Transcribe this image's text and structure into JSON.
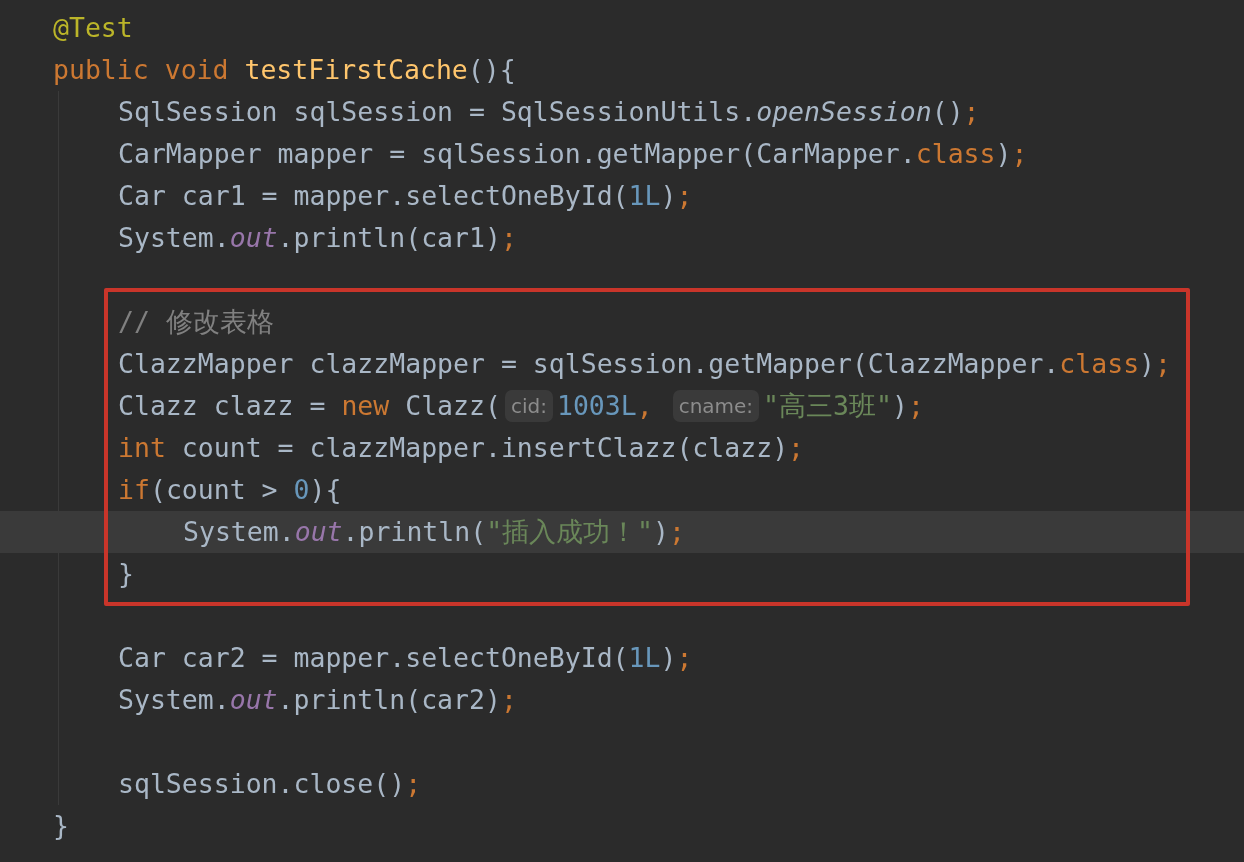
{
  "lines": [
    {
      "kind": "line",
      "tokens": [
        {
          "kind": "annotation",
          "text": "@Test"
        }
      ]
    },
    {
      "kind": "line",
      "tokens": [
        {
          "kind": "keyword",
          "text": "public void "
        },
        {
          "kind": "method",
          "text": "testFirstCache"
        },
        {
          "kind": "plain",
          "text": "(){"
        }
      ],
      "children": [
        {
          "kind": "line",
          "tokens": [
            {
              "kind": "plain",
              "text": "SqlSession sqlSession = SqlSessionUtils."
            },
            {
              "kind": "italic",
              "text": "openSession"
            },
            {
              "kind": "plain",
              "text": "()"
            },
            {
              "kind": "keyword",
              "text": ";"
            }
          ]
        },
        {
          "kind": "line",
          "tokens": [
            {
              "kind": "plain",
              "text": "CarMapper mapper = sqlSession.getMapper(CarMapper."
            },
            {
              "kind": "keyword",
              "text": "class"
            },
            {
              "kind": "plain",
              "text": ")"
            },
            {
              "kind": "keyword",
              "text": ";"
            }
          ]
        },
        {
          "kind": "line",
          "tokens": [
            {
              "kind": "plain",
              "text": "Car car1 = mapper.selectOneById("
            },
            {
              "kind": "number",
              "text": "1L"
            },
            {
              "kind": "plain",
              "text": ")"
            },
            {
              "kind": "keyword",
              "text": ";"
            }
          ]
        },
        {
          "kind": "line",
          "tokens": [
            {
              "kind": "plain",
              "text": "System."
            },
            {
              "kind": "field",
              "text": "out"
            },
            {
              "kind": "plain",
              "text": ".println(car1)"
            },
            {
              "kind": "keyword",
              "text": ";"
            }
          ]
        },
        {
          "kind": "blank"
        },
        {
          "kind": "frame",
          "children": [
            {
              "kind": "line",
              "tokens": [
                {
                  "kind": "comment",
                  "text": "// 修改表格"
                }
              ]
            },
            {
              "kind": "line",
              "tokens": [
                {
                  "kind": "plain",
                  "text": "ClazzMapper clazzMapper = sqlSession.getMapper(ClazzMapper."
                },
                {
                  "kind": "keyword",
                  "text": "class"
                },
                {
                  "kind": "plain",
                  "text": ")"
                },
                {
                  "kind": "keyword",
                  "text": ";"
                }
              ]
            },
            {
              "kind": "line",
              "tokens": [
                {
                  "kind": "plain",
                  "text": "Clazz clazz = "
                },
                {
                  "kind": "keyword",
                  "text": "new "
                },
                {
                  "kind": "plain",
                  "text": "Clazz("
                },
                {
                  "kind": "hint",
                  "text": "cid:"
                },
                {
                  "kind": "number",
                  "text": "1003L"
                },
                {
                  "kind": "keyword",
                  "text": ", "
                },
                {
                  "kind": "hint",
                  "text": "cname:"
                },
                {
                  "kind": "string",
                  "text": "\"高三3班\""
                },
                {
                  "kind": "plain",
                  "text": ")"
                },
                {
                  "kind": "keyword",
                  "text": ";"
                }
              ]
            },
            {
              "kind": "line",
              "tokens": [
                {
                  "kind": "keyword",
                  "text": "int "
                },
                {
                  "kind": "plain",
                  "text": "count = clazzMapper.insertClazz(clazz)"
                },
                {
                  "kind": "keyword",
                  "text": ";"
                }
              ]
            },
            {
              "kind": "line",
              "tokens": [
                {
                  "kind": "keyword",
                  "text": "if"
                },
                {
                  "kind": "plain",
                  "text": "(count > "
                },
                {
                  "kind": "number",
                  "text": "0"
                },
                {
                  "kind": "plain",
                  "text": "){"
                }
              ],
              "children": [
                {
                  "kind": "line",
                  "current": true,
                  "tokens": [
                    {
                      "kind": "plain",
                      "text": "System."
                    },
                    {
                      "kind": "field",
                      "text": "out"
                    },
                    {
                      "kind": "plain",
                      "text": ".println("
                    },
                    {
                      "kind": "string",
                      "text": "\"插入成功！\""
                    },
                    {
                      "kind": "plain",
                      "text": ")"
                    },
                    {
                      "kind": "keyword",
                      "text": ";"
                    }
                  ]
                }
              ]
            },
            {
              "kind": "line",
              "tokens": [
                {
                  "kind": "plain",
                  "text": "}"
                }
              ]
            }
          ]
        },
        {
          "kind": "blank"
        },
        {
          "kind": "line",
          "tokens": [
            {
              "kind": "plain",
              "text": "Car car2 = mapper.selectOneById("
            },
            {
              "kind": "number",
              "text": "1L"
            },
            {
              "kind": "plain",
              "text": ")"
            },
            {
              "kind": "keyword",
              "text": ";"
            }
          ]
        },
        {
          "kind": "line",
          "tokens": [
            {
              "kind": "plain",
              "text": "System."
            },
            {
              "kind": "field",
              "text": "out"
            },
            {
              "kind": "plain",
              "text": ".println(car2)"
            },
            {
              "kind": "keyword",
              "text": ";"
            }
          ]
        },
        {
          "kind": "blank"
        },
        {
          "kind": "line",
          "tokens": [
            {
              "kind": "plain",
              "text": "sqlSession.close()"
            },
            {
              "kind": "keyword",
              "text": ";"
            }
          ]
        }
      ]
    },
    {
      "kind": "line",
      "tokens": [
        {
          "kind": "plain",
          "text": "}"
        }
      ]
    }
  ]
}
